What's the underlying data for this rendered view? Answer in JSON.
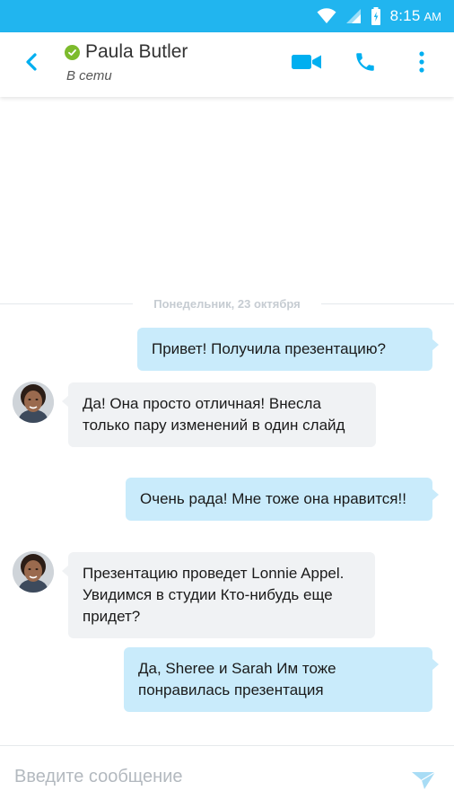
{
  "status_bar": {
    "time": "8:15",
    "ampm": "AM"
  },
  "header": {
    "contact_name": "Paula Butler",
    "contact_status": "В сети"
  },
  "conversation": {
    "date_separator": "Понедельник, 23 октября",
    "messages": [
      {
        "direction": "outgoing",
        "text": "Привет! Получила презентацию?"
      },
      {
        "direction": "incoming",
        "text": "Да! Она просто отличная! Внесла только пару изменений в один слайд"
      },
      {
        "direction": "outgoing",
        "text": "Очень рада! Мне тоже она нравится!!"
      },
      {
        "direction": "incoming",
        "text": "Презентацию проведет Lonnie Appel. Увидимся в студии Кто-нибудь еще придет?"
      },
      {
        "direction": "outgoing",
        "text": "Да, Sheree и Sarah Им тоже понравилась презентация"
      }
    ]
  },
  "compose": {
    "placeholder": "Введите сообщение",
    "value": ""
  },
  "icons": {
    "back": "chevron-left-icon",
    "presence": "check-circle-icon",
    "video": "video-camera-icon",
    "call": "phone-icon",
    "more": "more-vertical-icon",
    "send": "paper-plane-icon"
  },
  "colors": {
    "accent": "#00aff0",
    "status_bar": "#21b5ef",
    "presence_online": "#7dbb2d",
    "outgoing_bubble": "#c9ebfb",
    "incoming_bubble": "#f0f2f4"
  }
}
